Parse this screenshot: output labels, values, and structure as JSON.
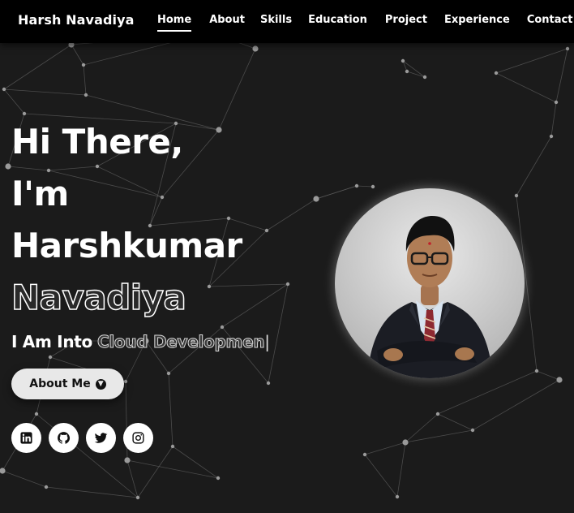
{
  "navbar": {
    "brand": "Harsh Navadiya",
    "links": [
      {
        "label": "Home",
        "active": true
      },
      {
        "label": "About"
      },
      {
        "label": "Skills"
      },
      {
        "label": "Education"
      },
      {
        "label": "Project"
      },
      {
        "label": "Experience"
      },
      {
        "label": "Contact"
      }
    ]
  },
  "hero": {
    "line1": "Hi There,",
    "line2": "I'm",
    "line3": "Harshkumar",
    "line4": "Navadiya",
    "tagline_prefix": "I Am Into",
    "tagline_typed": "Cloud Developmen",
    "tagline_caret": "|",
    "about_button": "About Me"
  },
  "socials": [
    {
      "icon": "linkedin-icon"
    },
    {
      "icon": "github-icon"
    },
    {
      "icon": "twitter-icon"
    },
    {
      "icon": "instagram-icon"
    }
  ],
  "profile": {
    "image": "profile-photo"
  },
  "theme": {
    "background": "#1b1b1b",
    "navbar": "#000000",
    "text": "#ffffff",
    "button_bg": "#e8e8e8"
  }
}
